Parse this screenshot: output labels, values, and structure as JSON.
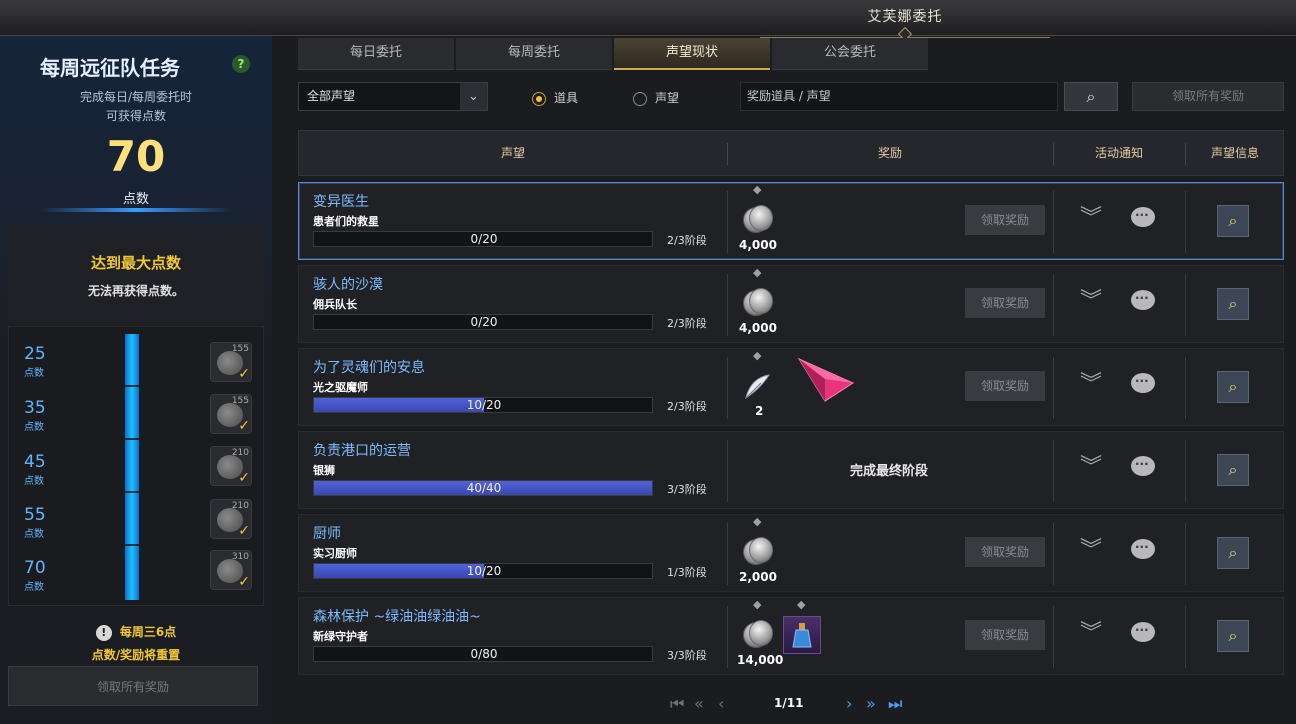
{
  "window": {
    "title": "艾芙娜委托"
  },
  "left_panel": {
    "title": "每周远征队任务",
    "help_icon": "?",
    "subtitle_line1": "完成每日/每周委托时",
    "subtitle_line2": "可获得点数",
    "points_value": "70",
    "points_unit": "点数",
    "max_title": "达到最大点数",
    "max_subtitle": "无法再获得点数。",
    "tiers": [
      {
        "num": "25",
        "unit": "点数",
        "reward": "155"
      },
      {
        "num": "35",
        "unit": "点数",
        "reward": "155"
      },
      {
        "num": "45",
        "unit": "点数",
        "reward": "210"
      },
      {
        "num": "55",
        "unit": "点数",
        "reward": "210"
      },
      {
        "num": "70",
        "unit": "点数",
        "reward": "310"
      }
    ],
    "reset_line1": "每周三6点",
    "reset_line2": "点数/奖励将重置",
    "claim_all_label": "领取所有奖励"
  },
  "tabs": [
    {
      "label": "每日委托"
    },
    {
      "label": "每周委托"
    },
    {
      "label": "声望现状"
    },
    {
      "label": "公会委托"
    }
  ],
  "active_tab": "声望现状",
  "filter": {
    "select_value": "全部声望",
    "radio_items_label": "道具",
    "radio_reputation_label": "声望",
    "search_placeholder": "奖励道具 / 声望",
    "claim_all_label": "领取所有奖励"
  },
  "table": {
    "headers": {
      "reputation": "声望",
      "reward": "奖励",
      "event_notice": "活动通知",
      "rep_info": "声望信息"
    },
    "claim_label": "领取奖励",
    "rows": [
      {
        "name": "变异医生",
        "title": "患者们的救星",
        "progress_text": "0/20",
        "progress_fraction": 0.0,
        "stage": "2/3阶段",
        "rewards": [
          {
            "type": "silver",
            "amount": "4,000"
          }
        ],
        "done": false
      },
      {
        "name": "骇人的沙漠",
        "title": "佣兵队长",
        "progress_text": "0/20",
        "progress_fraction": 0.0,
        "stage": "2/3阶段",
        "rewards": [
          {
            "type": "silver",
            "amount": "4,000"
          }
        ],
        "done": false
      },
      {
        "name": "为了灵魂们的安息",
        "title": "光之驱魔师",
        "progress_text": "10/20",
        "progress_fraction": 0.5,
        "stage": "2/3阶段",
        "rewards": [
          {
            "type": "feather",
            "amount": "2"
          },
          {
            "type": "gem",
            "amount": ""
          }
        ],
        "done": false
      },
      {
        "name": "负责港口的运营",
        "title": "银狮",
        "progress_text": "40/40",
        "progress_fraction": 1.0,
        "stage": "3/3阶段",
        "done_text": "完成最终阶段",
        "done": true
      },
      {
        "name": "厨师",
        "title": "实习厨师",
        "progress_text": "10/20",
        "progress_fraction": 0.5,
        "stage": "1/3阶段",
        "rewards": [
          {
            "type": "silver",
            "amount": "2,000"
          }
        ],
        "done": false
      },
      {
        "name": "森林保护 ~绿油油绿油油~",
        "title": "新绿守护者",
        "progress_text": "0/80",
        "progress_fraction": 0.0,
        "stage": "3/3阶段",
        "rewards": [
          {
            "type": "silver",
            "amount": "14,000"
          },
          {
            "type": "potion",
            "amount": ""
          }
        ],
        "done": false
      }
    ]
  },
  "pager": {
    "text": "1/11"
  },
  "colors": {
    "accent_blue": "#4f9cf0",
    "gold": "#f2c830",
    "progress": "#4a58c8"
  }
}
